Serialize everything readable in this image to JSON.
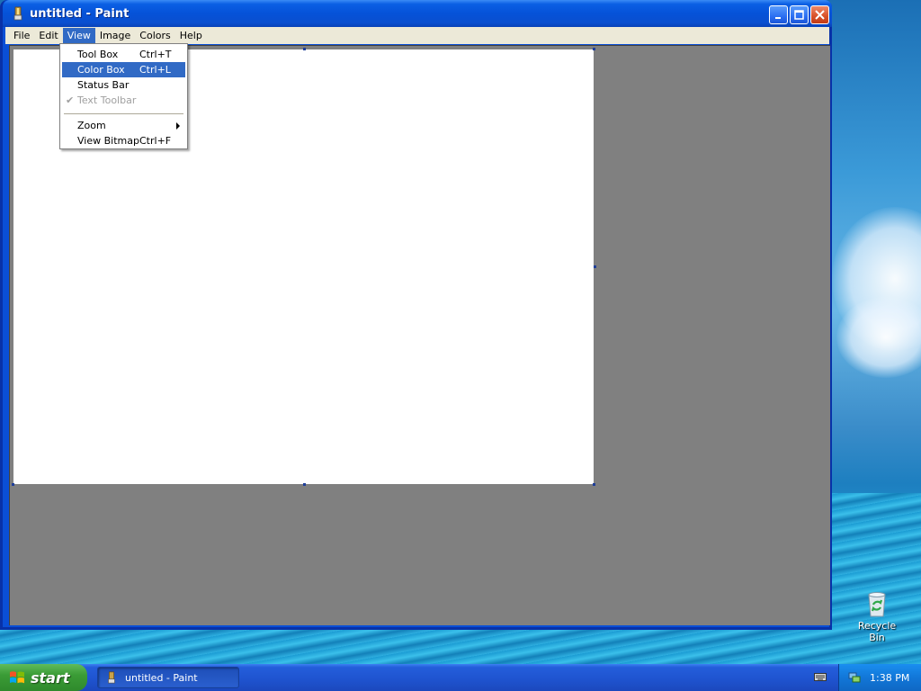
{
  "window": {
    "title": "untitled - Paint",
    "controls": {
      "minimize": "minimize",
      "maximize": "maximize",
      "close": "close"
    }
  },
  "menubar": {
    "items": [
      {
        "label": "File"
      },
      {
        "label": "Edit"
      },
      {
        "label": "View",
        "active": true
      },
      {
        "label": "Image"
      },
      {
        "label": "Colors"
      },
      {
        "label": "Help"
      }
    ]
  },
  "view_menu": {
    "items": [
      {
        "label": "Tool Box",
        "shortcut": "Ctrl+T"
      },
      {
        "label": "Color Box",
        "shortcut": "Ctrl+L",
        "highlighted": true
      },
      {
        "label": "Status Bar",
        "shortcut": ""
      },
      {
        "label": "Text Toolbar",
        "shortcut": "",
        "disabled": true,
        "checked": true
      },
      {
        "label": "Zoom",
        "shortcut": "",
        "submenu": true
      },
      {
        "label": "View Bitmap",
        "shortcut": "Ctrl+F"
      }
    ]
  },
  "desktop": {
    "recycle_bin_label": "Recycle Bin"
  },
  "taskbar": {
    "start_label": "start",
    "task_button_label": "untitled - Paint",
    "clock": "1:38 PM"
  },
  "colors": {
    "workspace": "#808080",
    "canvas": "#ffffff",
    "menu_highlight": "#316ac5",
    "titlebar": "#0552d8"
  }
}
